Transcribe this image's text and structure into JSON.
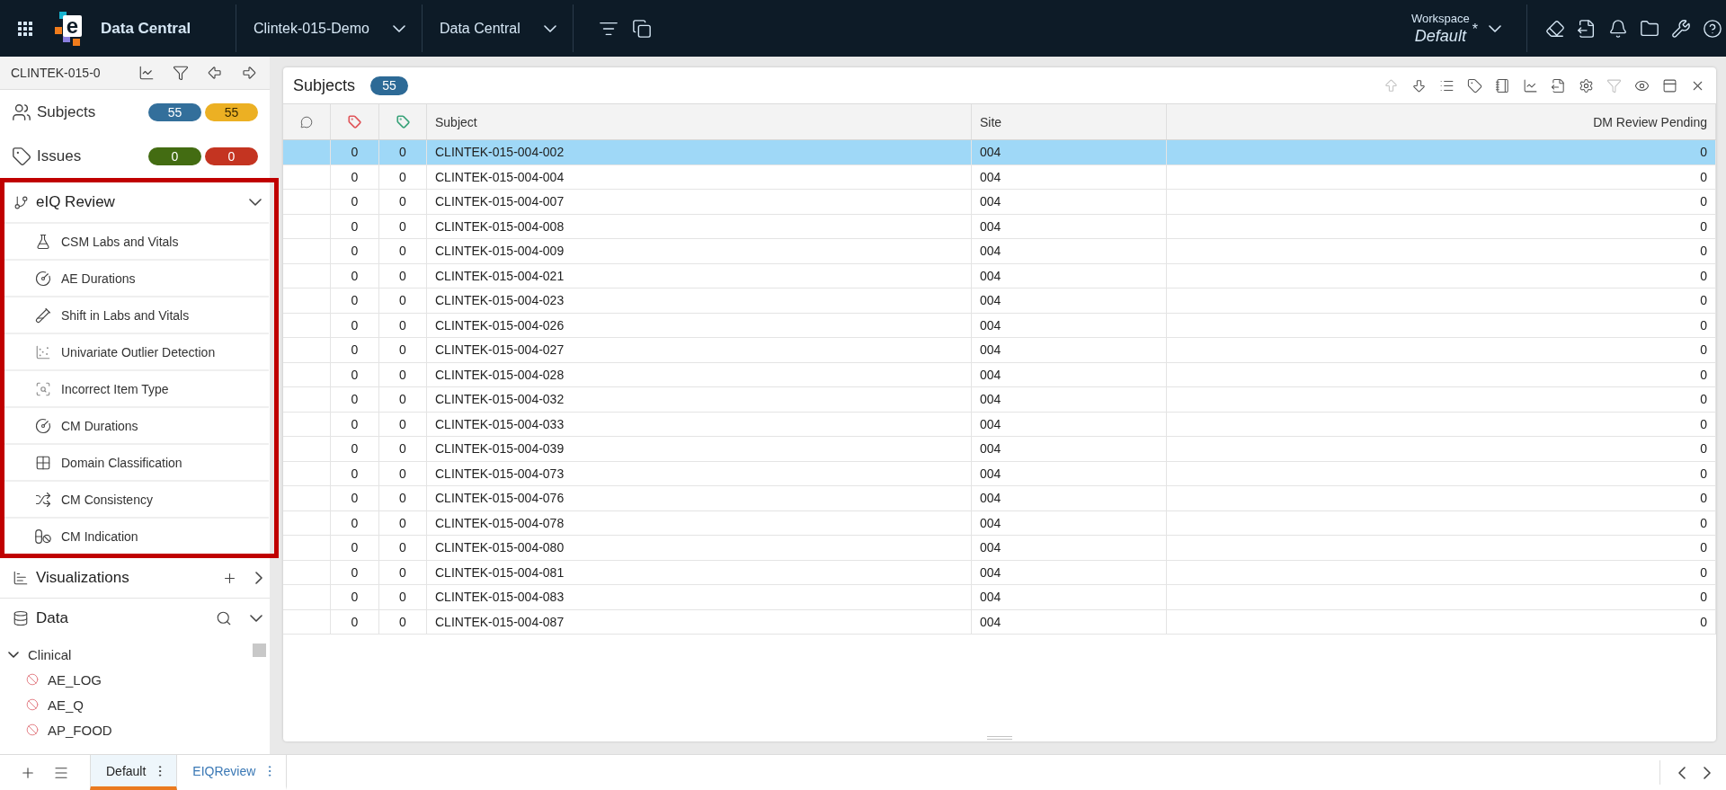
{
  "top_bar": {
    "logo": {
      "letter": "e"
    },
    "app_title": "Data Central",
    "selectors": [
      {
        "label": "Clintek-015-Demo"
      },
      {
        "label": "Data Central"
      }
    ],
    "workspace": {
      "label": "Workspace",
      "name": "Default",
      "modified_mark": "*"
    }
  },
  "sidebar": {
    "study_label": "CLINTEK-015-0",
    "summary": [
      {
        "kind": "subjects",
        "label": "Subjects",
        "badges": [
          {
            "text": "55",
            "color": "#336f9b"
          },
          {
            "text": "55",
            "color": "#ecb023"
          }
        ]
      },
      {
        "kind": "issues",
        "label": "Issues",
        "badges": [
          {
            "text": "0",
            "color": "#436c12"
          },
          {
            "text": "0",
            "color": "#c43421"
          }
        ]
      }
    ],
    "eiq_review": {
      "title": "eIQ Review",
      "expanded": true,
      "highlighted": true,
      "items": [
        {
          "kind": "labs",
          "label": "CSM Labs and Vitals"
        },
        {
          "kind": "duration",
          "label": "AE Durations"
        },
        {
          "kind": "shift",
          "label": "Shift in Labs and Vitals"
        },
        {
          "kind": "outlier",
          "label": "Univariate Outlier Detection"
        },
        {
          "kind": "itemtype",
          "label": "Incorrect Item Type"
        },
        {
          "kind": "duration",
          "label": "CM Durations"
        },
        {
          "kind": "domain",
          "label": "Domain Classification"
        },
        {
          "kind": "consistency",
          "label": "CM Consistency"
        },
        {
          "kind": "indication",
          "label": "CM Indication"
        }
      ]
    },
    "visualizations": {
      "title": "Visualizations",
      "expanded": false
    },
    "data": {
      "title": "Data",
      "expanded": true,
      "tree": [
        {
          "label": "Clinical",
          "expanded": true,
          "children": [
            {
              "label": "AE_LOG"
            },
            {
              "label": "AE_Q"
            },
            {
              "label": "AP_FOOD"
            }
          ]
        }
      ]
    }
  },
  "panel": {
    "title": "Subjects",
    "count": "55",
    "toolbar": [
      {
        "kind": "up",
        "disabled": true
      },
      {
        "kind": "down",
        "disabled": false
      },
      {
        "kind": "list",
        "disabled": false
      },
      {
        "kind": "tag",
        "disabled": false
      },
      {
        "kind": "book",
        "disabled": false
      },
      {
        "kind": "chart",
        "disabled": false
      },
      {
        "kind": "export",
        "disabled": false
      },
      {
        "kind": "settings",
        "disabled": false
      },
      {
        "kind": "filter",
        "disabled": true
      },
      {
        "kind": "view",
        "disabled": false
      },
      {
        "kind": "layout",
        "disabled": false
      },
      {
        "kind": "close",
        "disabled": false
      }
    ],
    "columns": [
      {
        "kind": "comment"
      },
      {
        "kind": "tag",
        "color": "#e0555a"
      },
      {
        "kind": "tag",
        "color": "#3aa37a"
      },
      {
        "kind": "text",
        "label": "Subject"
      },
      {
        "kind": "text",
        "label": "Site"
      },
      {
        "kind": "number",
        "label": "DM Review Pending"
      }
    ],
    "rows": [
      {
        "selected": true,
        "cells": [
          "",
          "0",
          "0",
          "CLINTEK-015-004-002",
          "004",
          "0"
        ]
      },
      {
        "selected": false,
        "cells": [
          "",
          "0",
          "0",
          "CLINTEK-015-004-004",
          "004",
          "0"
        ]
      },
      {
        "selected": false,
        "cells": [
          "",
          "0",
          "0",
          "CLINTEK-015-004-007",
          "004",
          "0"
        ]
      },
      {
        "selected": false,
        "cells": [
          "",
          "0",
          "0",
          "CLINTEK-015-004-008",
          "004",
          "0"
        ]
      },
      {
        "selected": false,
        "cells": [
          "",
          "0",
          "0",
          "CLINTEK-015-004-009",
          "004",
          "0"
        ]
      },
      {
        "selected": false,
        "cells": [
          "",
          "0",
          "0",
          "CLINTEK-015-004-021",
          "004",
          "0"
        ]
      },
      {
        "selected": false,
        "cells": [
          "",
          "0",
          "0",
          "CLINTEK-015-004-023",
          "004",
          "0"
        ]
      },
      {
        "selected": false,
        "cells": [
          "",
          "0",
          "0",
          "CLINTEK-015-004-026",
          "004",
          "0"
        ]
      },
      {
        "selected": false,
        "cells": [
          "",
          "0",
          "0",
          "CLINTEK-015-004-027",
          "004",
          "0"
        ]
      },
      {
        "selected": false,
        "cells": [
          "",
          "0",
          "0",
          "CLINTEK-015-004-028",
          "004",
          "0"
        ]
      },
      {
        "selected": false,
        "cells": [
          "",
          "0",
          "0",
          "CLINTEK-015-004-032",
          "004",
          "0"
        ]
      },
      {
        "selected": false,
        "cells": [
          "",
          "0",
          "0",
          "CLINTEK-015-004-033",
          "004",
          "0"
        ]
      },
      {
        "selected": false,
        "cells": [
          "",
          "0",
          "0",
          "CLINTEK-015-004-039",
          "004",
          "0"
        ]
      },
      {
        "selected": false,
        "cells": [
          "",
          "0",
          "0",
          "CLINTEK-015-004-073",
          "004",
          "0"
        ]
      },
      {
        "selected": false,
        "cells": [
          "",
          "0",
          "0",
          "CLINTEK-015-004-076",
          "004",
          "0"
        ]
      },
      {
        "selected": false,
        "cells": [
          "",
          "0",
          "0",
          "CLINTEK-015-004-078",
          "004",
          "0"
        ]
      },
      {
        "selected": false,
        "cells": [
          "",
          "0",
          "0",
          "CLINTEK-015-004-080",
          "004",
          "0"
        ]
      },
      {
        "selected": false,
        "cells": [
          "",
          "0",
          "0",
          "CLINTEK-015-004-081",
          "004",
          "0"
        ]
      },
      {
        "selected": false,
        "cells": [
          "",
          "0",
          "0",
          "CLINTEK-015-004-083",
          "004",
          "0"
        ]
      },
      {
        "selected": false,
        "cells": [
          "",
          "0",
          "0",
          "CLINTEK-015-004-087",
          "004",
          "0"
        ]
      }
    ]
  },
  "bottom_bar": {
    "tabs": [
      {
        "label": "Default",
        "selected": true
      },
      {
        "label": "EIQReview",
        "selected": false
      }
    ]
  }
}
